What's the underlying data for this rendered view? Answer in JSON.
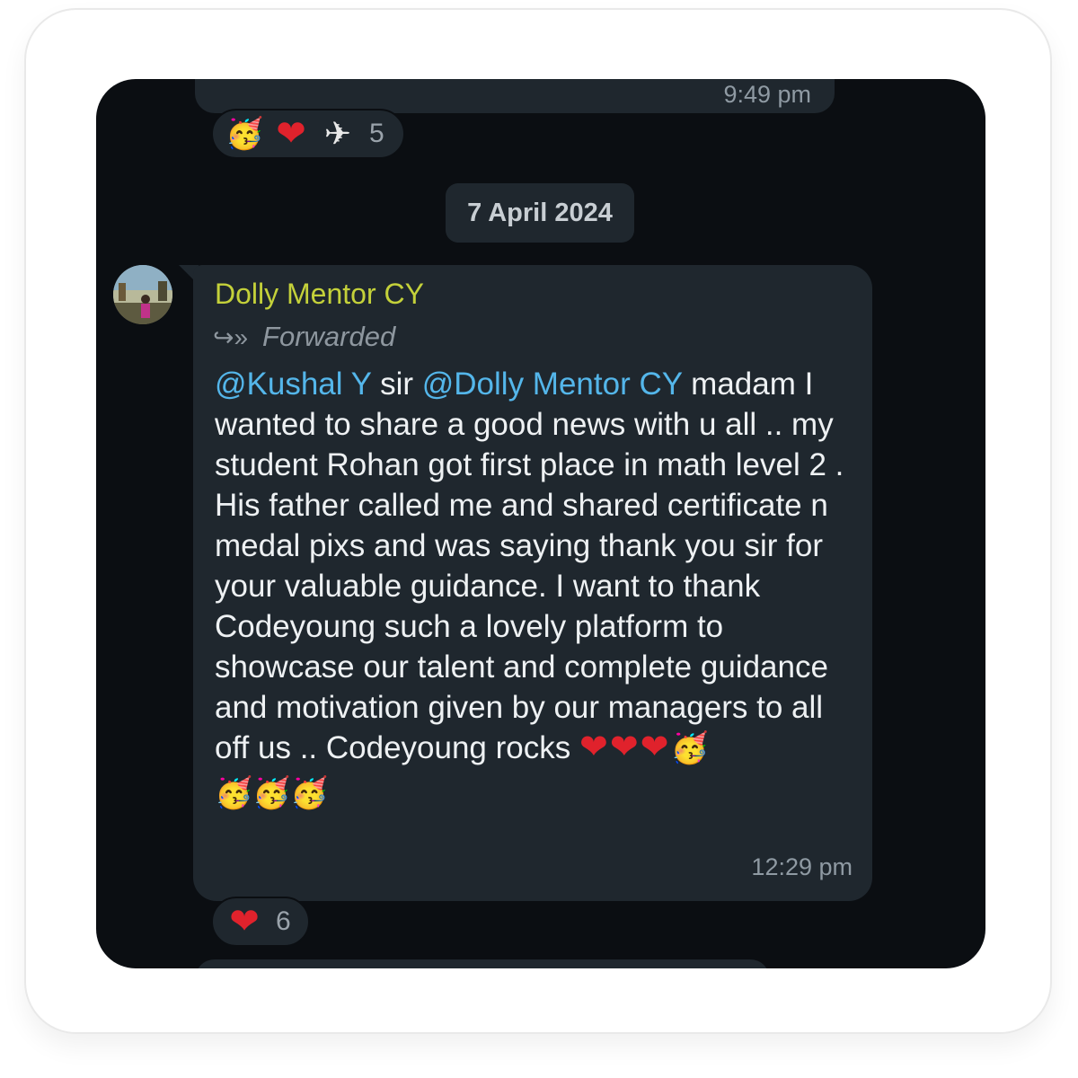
{
  "previous_message": {
    "time": "9:49 pm",
    "reactions": {
      "emojis": [
        "party-face",
        "red-heart",
        "airplane"
      ],
      "count": "5"
    }
  },
  "date_separator": "7 April 2024",
  "message": {
    "sender": "Dolly Mentor CY",
    "forwarded_label": "Forwarded",
    "mention_1": "@Kushal Y",
    "text_1": " sir ",
    "mention_2": "@Dolly Mentor CY",
    "text_2": " madam I wanted to share a good news with u all .. my student Rohan got first place in math level 2 . His father called me and shared certificate n medal pixs and was saying thank you sir for your valuable guidance. I want to thank Codeyoung such a lovely platform to showcase our talent and complete guidance and motivation given by our managers to all off us .. Codeyoung rocks ",
    "inline_emojis": [
      "red-heart",
      "red-heart",
      "red-heart",
      "party-face"
    ],
    "trailing_emojis": [
      "party-face",
      "party-face",
      "party-face"
    ],
    "time": "12:29 pm",
    "reactions": {
      "emojis": [
        "red-heart"
      ],
      "count": "6"
    }
  },
  "colors": {
    "sender": "#c4d13a",
    "mention": "#54b6ea",
    "bubble": "#1f272e",
    "background": "#0b0e12"
  }
}
